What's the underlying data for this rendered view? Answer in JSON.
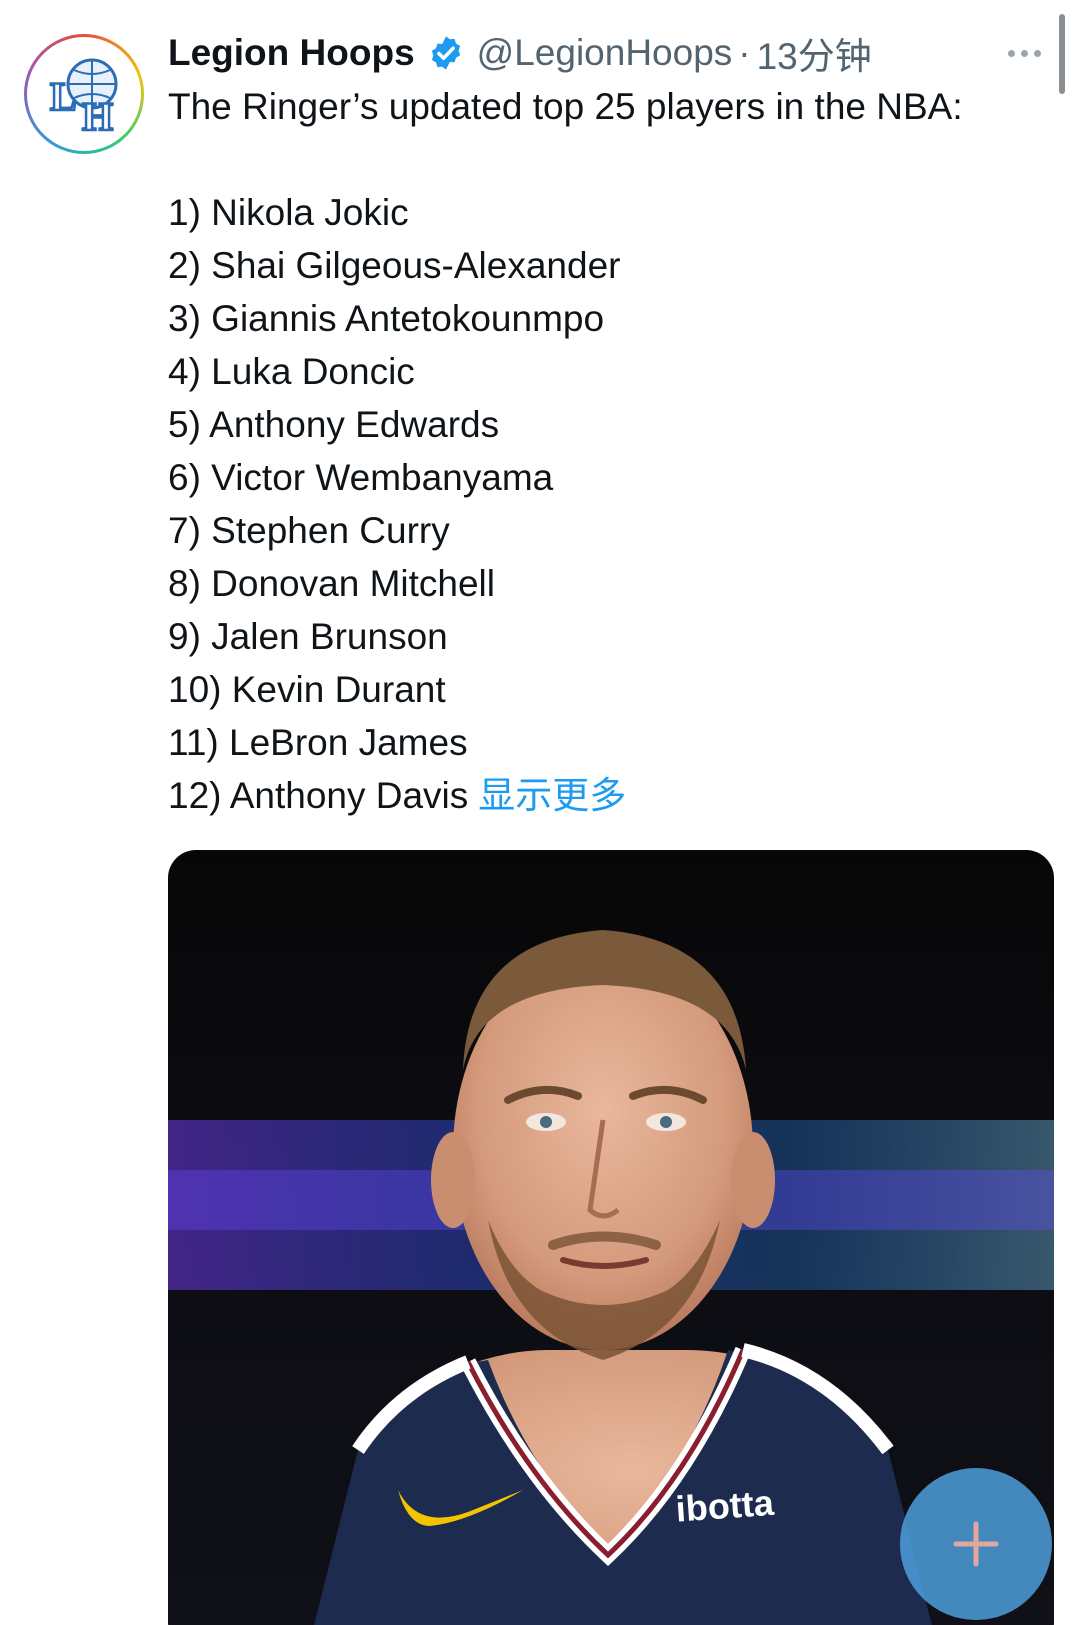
{
  "tweet": {
    "author": {
      "display_name": "Legion Hoops",
      "handle": "@LegionHoops",
      "time": "13分钟",
      "avatar_monogram": "LH"
    },
    "separator": "·",
    "intro": "The Ringer’s updated top 25 players in the NBA:",
    "ranking": [
      "1) Nikola Jokic",
      "2) Shai Gilgeous-Alexander",
      "3) Giannis Antetokounmpo",
      "4) Luka Doncic",
      "5) Anthony Edwards",
      "6) Victor Wembanyama",
      "7) Stephen Curry",
      "8) Donovan Mitchell",
      "9) Jalen Brunson",
      "10) Kevin Durant",
      "11) LeBron James",
      "12) Anthony Davis"
    ],
    "show_more": "显示更多",
    "media": {
      "jersey_sponsor": "ibotta"
    }
  },
  "icons": {
    "verified": "verified-badge-icon",
    "more": "more-horizontal-icon",
    "compose": "plus-icon"
  },
  "colors": {
    "link": "#1d9bf0",
    "secondary_text": "#536471",
    "fab": "#4d9fdc"
  }
}
